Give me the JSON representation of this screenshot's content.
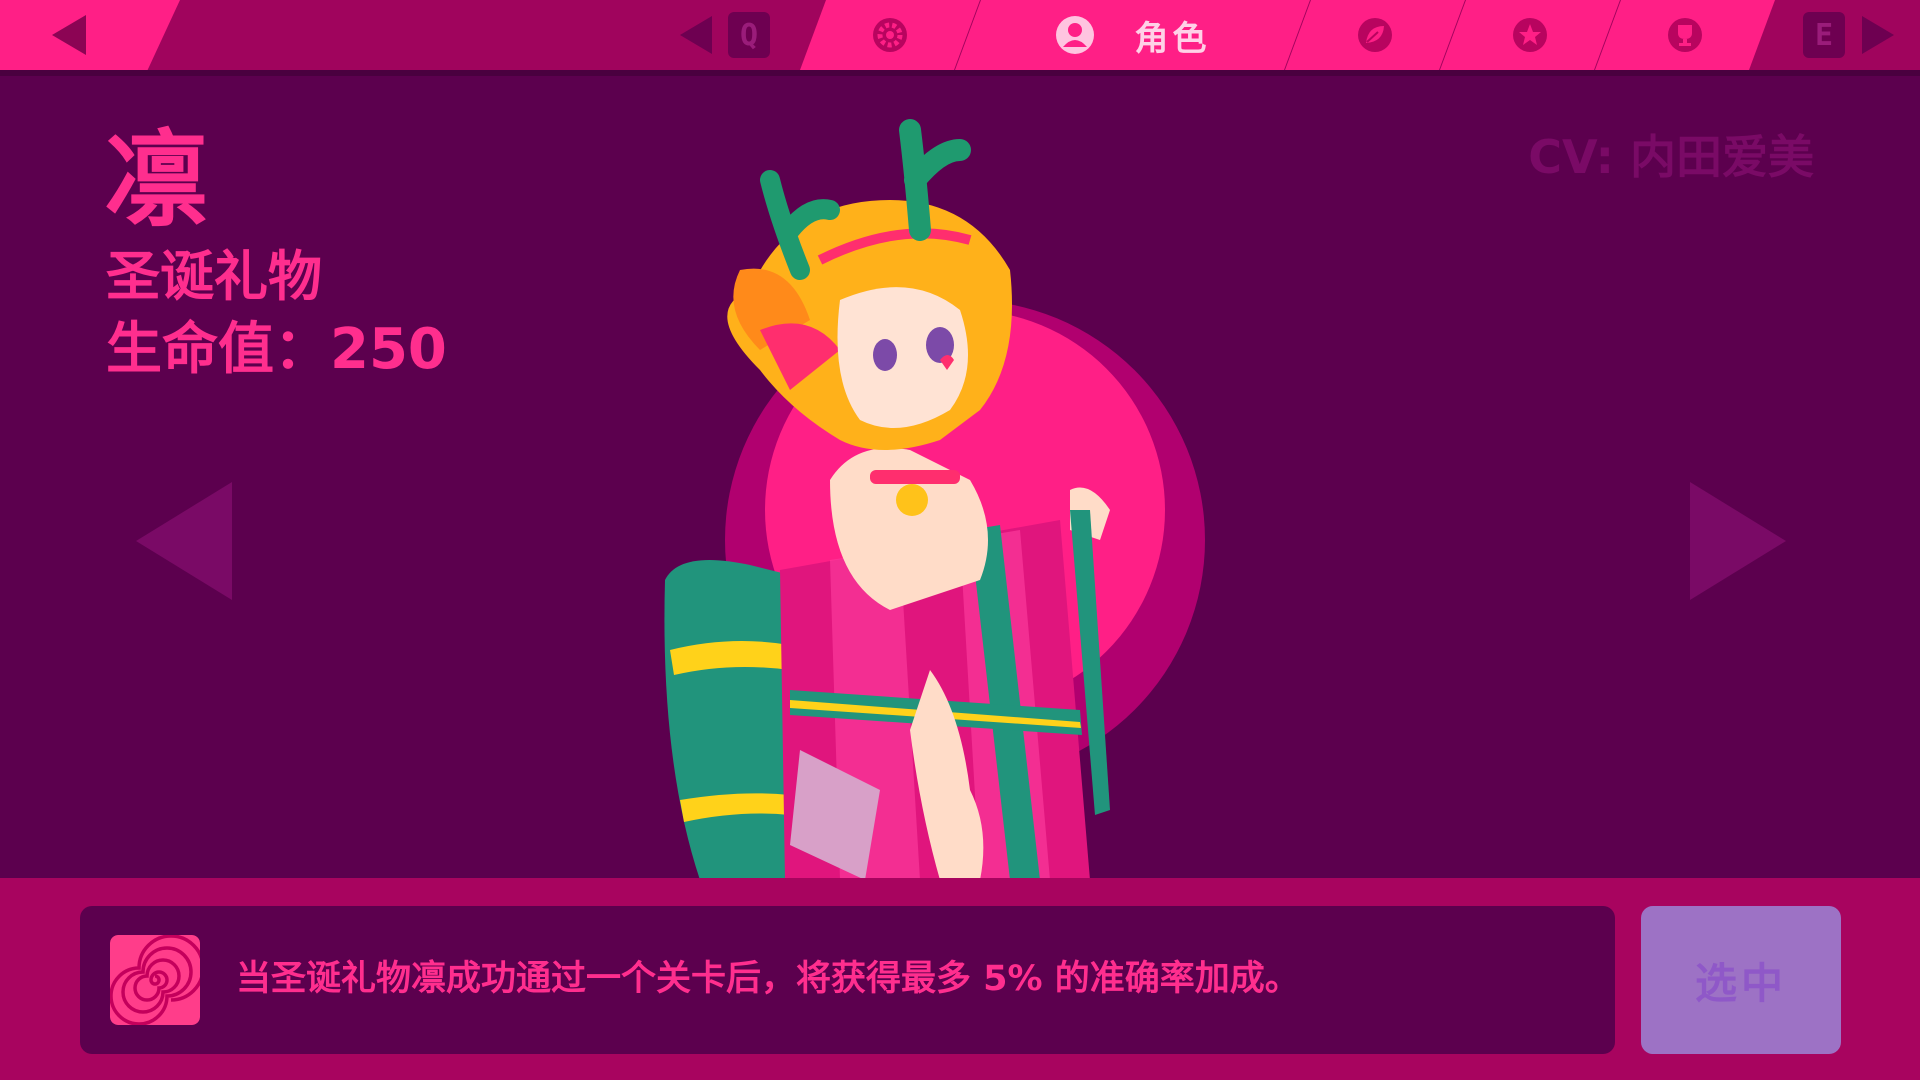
{
  "nav": {
    "prev_key": "Q",
    "next_key": "E",
    "tabs": [
      {
        "id": "settings",
        "icon": "gear-icon"
      },
      {
        "id": "character",
        "icon": "user-icon",
        "label": "角色",
        "active": true
      },
      {
        "id": "leaf",
        "icon": "leaf-icon"
      },
      {
        "id": "star",
        "icon": "star-icon"
      },
      {
        "id": "trophy",
        "icon": "trophy-icon"
      }
    ]
  },
  "character": {
    "name": "凛",
    "skin": "圣诞礼物",
    "hp": "生命值：250",
    "cv": "CV: 内田爱美"
  },
  "skill": {
    "icon": "spiral-icon",
    "description": "当圣诞礼物凛成功通过一个关卡后，将获得最多 5% 的准确率加成。"
  },
  "actions": {
    "select_label": "选中"
  },
  "colors": {
    "background": "#5c004e",
    "accent_pink": "#ff1f86",
    "bar": "#a0045d",
    "select_button": "#9d72c5"
  }
}
